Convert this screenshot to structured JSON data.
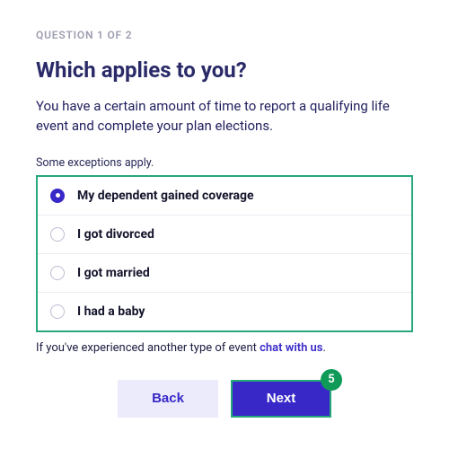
{
  "stepIndicator": "QUESTION 1 OF 2",
  "heading": "Which applies to you?",
  "description": "You have a certain amount of time to report a qualifying life event and complete your plan elections.",
  "hint": "Some exceptions apply.",
  "options": [
    {
      "label": "My dependent gained coverage",
      "selected": true
    },
    {
      "label": "I got divorced",
      "selected": false
    },
    {
      "label": "I got married",
      "selected": false
    },
    {
      "label": "I had a baby",
      "selected": false
    }
  ],
  "footnote_prefix": "If you've experienced another type of event ",
  "footnote_link": "chat with us",
  "footnote_suffix": ".",
  "buttons": {
    "back": "Back",
    "next": "Next",
    "badge": "5"
  }
}
